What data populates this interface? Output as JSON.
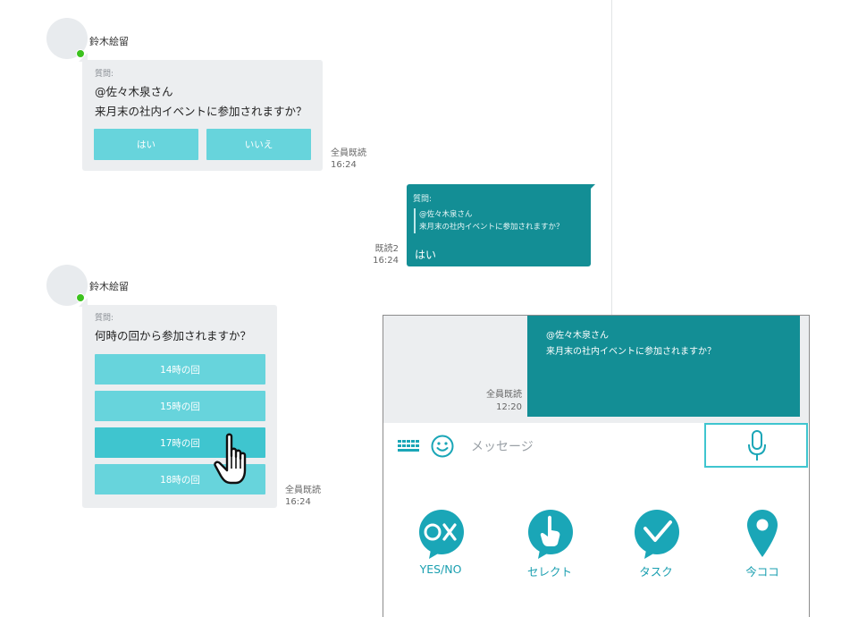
{
  "messages": {
    "first": {
      "sender": "鈴木絵留",
      "label": "質問:",
      "line1": "@佐々木泉さん",
      "line2": "来月末の社内イベントに参加されますか？",
      "buttons": [
        "はい",
        "いいえ"
      ],
      "read_status": "全員既読",
      "time": "16:24"
    },
    "reply": {
      "label": "質問:",
      "quote_line1": "@佐々木泉さん",
      "quote_line2": "来月末の社内イベントに参加されますか？",
      "answer": "はい",
      "read_status": "既読2",
      "time": "16:24"
    },
    "second": {
      "sender": "鈴木絵留",
      "label": "質問:",
      "text": "何時の回から参加されますか？",
      "options": [
        "14時の回",
        "15時の回",
        "17時の回",
        "18時の回"
      ],
      "read_status": "全員既読",
      "time": "16:24"
    }
  },
  "phone": {
    "bubble_line1": "@佐々木泉さん",
    "bubble_line2": "来月末の社内イベントに参加されますか？",
    "read_status": "全員既読",
    "time": "12:20",
    "input_placeholder": "メッセージ",
    "actions": [
      {
        "label": "YES/NO",
        "icon": "yes-no-icon"
      },
      {
        "label": "セレクト",
        "icon": "select-finger-icon"
      },
      {
        "label": "タスク",
        "icon": "task-check-icon"
      },
      {
        "label": "今ココ",
        "icon": "location-pin-icon"
      }
    ]
  },
  "colors": {
    "accent": "#1a9fb0",
    "button": "#67d4dc",
    "button_active": "#3fc5cf",
    "own_bubble": "#138e95",
    "online": "#3cc21e"
  }
}
